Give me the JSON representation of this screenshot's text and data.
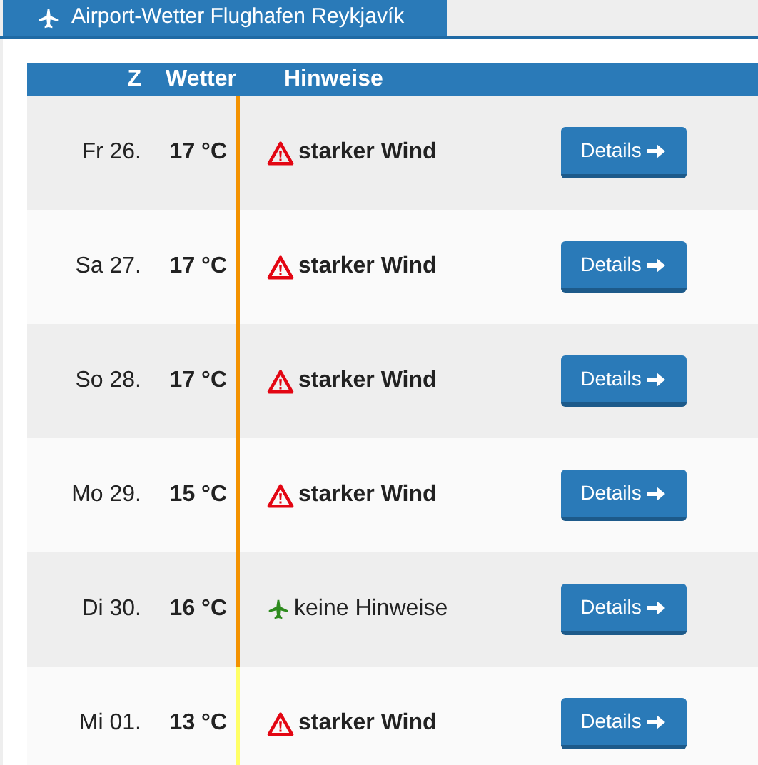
{
  "tab": {
    "title": "Airport-Wetter Flughafen Reykjavík"
  },
  "table": {
    "columns": [
      "Z",
      "Wetter",
      "Hinweise"
    ],
    "rows": [
      {
        "day": "Fr 26.",
        "temp": "17 °C",
        "color": "#f39200",
        "hint": {
          "kind": "warning",
          "text": "starker Wind"
        },
        "button": "Details"
      },
      {
        "day": "Sa 27.",
        "temp": "17 °C",
        "color": "#f39200",
        "hint": {
          "kind": "warning",
          "text": "starker Wind"
        },
        "button": "Details"
      },
      {
        "day": "So 28.",
        "temp": "17 °C",
        "color": "#f39200",
        "hint": {
          "kind": "warning",
          "text": "starker Wind"
        },
        "button": "Details"
      },
      {
        "day": "Mo 29.",
        "temp": "15 °C",
        "color": "#f39200",
        "hint": {
          "kind": "warning",
          "text": "starker Wind"
        },
        "button": "Details"
      },
      {
        "day": "Di 30.",
        "temp": "16 °C",
        "color": "#f39200",
        "hint": {
          "kind": "none",
          "text": "keine Hinweise"
        },
        "button": "Details"
      },
      {
        "day": "Mi 01.",
        "temp": "13 °C",
        "color": "#ffff66",
        "hint": {
          "kind": "warning",
          "text": "starker Wind"
        },
        "button": "Details"
      }
    ]
  }
}
